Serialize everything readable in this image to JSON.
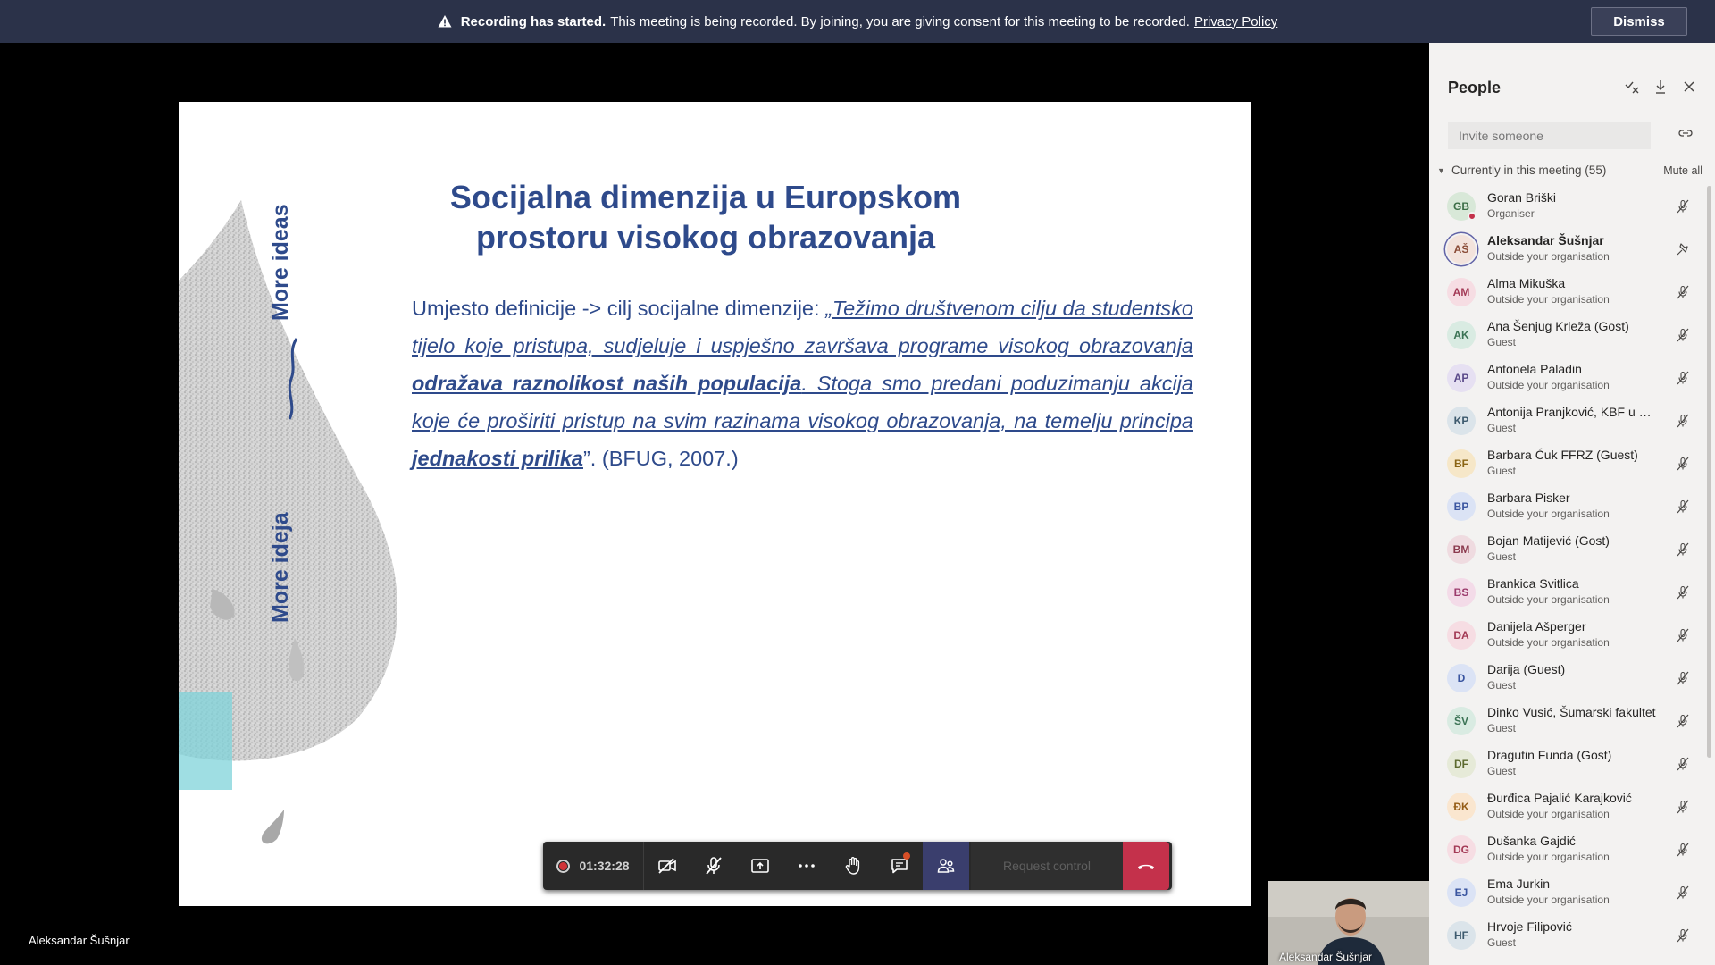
{
  "banner": {
    "strong": "Recording has started.",
    "text": "This meeting is being recorded. By joining, you are giving consent for this meeting to be recorded.",
    "link": "Privacy Policy",
    "dismiss": "Dismiss"
  },
  "slide": {
    "title": "Socijalna dimenzija u Europskom prostoru visokog obrazovanja",
    "vertical_1": "More ideas",
    "vertical_2": "More ideja",
    "body_intro": "Umjesto definicije -> cilj socijalne dimenzije: ",
    "body_quote_1": "„Težimo društvenom cilju da studentsko tijelo koje pristupa, sudjeluje i uspješno završava programe visokog obrazovanja ",
    "body_bold_1": "odražava raznolikost naših populacija",
    "body_quote_2": ". Stoga smo predani poduzimanju akcija koje će proširiti pristup na svim razinama visokog obrazovanja, na temelju principa ",
    "body_bold_2": "jednakosti prilika",
    "body_end": "”. (BFUG, 2007.)"
  },
  "controls": {
    "timer": "01:32:28",
    "request_control": "Request control"
  },
  "presenter_name": "Aleksandar Šušnjar",
  "selfview_name": "Aleksandar Šušnjar",
  "people": {
    "title": "People",
    "invite_placeholder": "Invite someone",
    "section_label": "Currently in this meeting (55)",
    "mute_all": "Mute all",
    "participants": [
      {
        "initials": "GB",
        "name": "Goran Briški",
        "role": "Organiser",
        "bg": "#d8e8d8",
        "fg": "#3c6e47"
      },
      {
        "initials": "AŠ",
        "name": "Aleksandar Šušnjar",
        "role": "Outside your organisation",
        "bg": "#f3e3dc",
        "fg": "#8a4b36"
      },
      {
        "initials": "AM",
        "name": "Alma Mikuška",
        "role": "Outside your organisation",
        "bg": "#f6dde3",
        "fg": "#a33a56"
      },
      {
        "initials": "AK",
        "name": "Ana Šenjug Krleža (Gost)",
        "role": "Guest",
        "bg": "#d9ebe2",
        "fg": "#3b7355"
      },
      {
        "initials": "AP",
        "name": "Antonela Paladin",
        "role": "Outside your organisation",
        "bg": "#e6e0f2",
        "fg": "#5b4a8a"
      },
      {
        "initials": "KP",
        "name": "Antonija Pranjković, KBF u Đakovu",
        "role": "Guest",
        "bg": "#dbe4ea",
        "fg": "#3d5a6e"
      },
      {
        "initials": "BF",
        "name": "Barbara Ćuk FFRZ (Guest)",
        "role": "Guest",
        "bg": "#f6e7c8",
        "fg": "#8a6414"
      },
      {
        "initials": "BP",
        "name": "Barbara Pisker",
        "role": "Outside your organisation",
        "bg": "#dbe3f5",
        "fg": "#3a55a0"
      },
      {
        "initials": "BM",
        "name": "Bojan Matijević (Gost)",
        "role": "Guest",
        "bg": "#efdbe0",
        "fg": "#8b3a4e"
      },
      {
        "initials": "BS",
        "name": "Brankica Svitlica",
        "role": "Outside your organisation",
        "bg": "#f3dbe8",
        "fg": "#9b3a6c"
      },
      {
        "initials": "DA",
        "name": "Danijela Ašperger",
        "role": "Outside your organisation",
        "bg": "#f6dde3",
        "fg": "#a33a56"
      },
      {
        "initials": "D",
        "name": "Darija (Guest)",
        "role": "Guest",
        "bg": "#dbe3f5",
        "fg": "#3a55a0"
      },
      {
        "initials": "ŠV",
        "name": "Dinko Vusić, Šumarski fakultet",
        "role": "Guest",
        "bg": "#d9ebe2",
        "fg": "#3b7355"
      },
      {
        "initials": "DF",
        "name": "Dragutin Funda (Gost)",
        "role": "Guest",
        "bg": "#e6ead8",
        "fg": "#5c6a2e"
      },
      {
        "initials": "ĐK",
        "name": "Đurđica Pajalić Karajković",
        "role": "Outside your organisation",
        "bg": "#fae6cf",
        "fg": "#955d17"
      },
      {
        "initials": "DG",
        "name": "Dušanka Gajdić",
        "role": "Outside your organisation",
        "bg": "#f6dde3",
        "fg": "#a33a56"
      },
      {
        "initials": "EJ",
        "name": "Ema Jurkin",
        "role": "Outside your organisation",
        "bg": "#dbe3f5",
        "fg": "#3a55a0"
      },
      {
        "initials": "HF",
        "name": "Hrvoje Filipović",
        "role": "Guest",
        "bg": "#dbe4ea",
        "fg": "#3d5a6e"
      }
    ]
  },
  "colors": {
    "banner_bg": "#2b3249",
    "slide_text": "#2e4a8b",
    "hangup": "#c4314b",
    "accent": "#6264a7"
  }
}
